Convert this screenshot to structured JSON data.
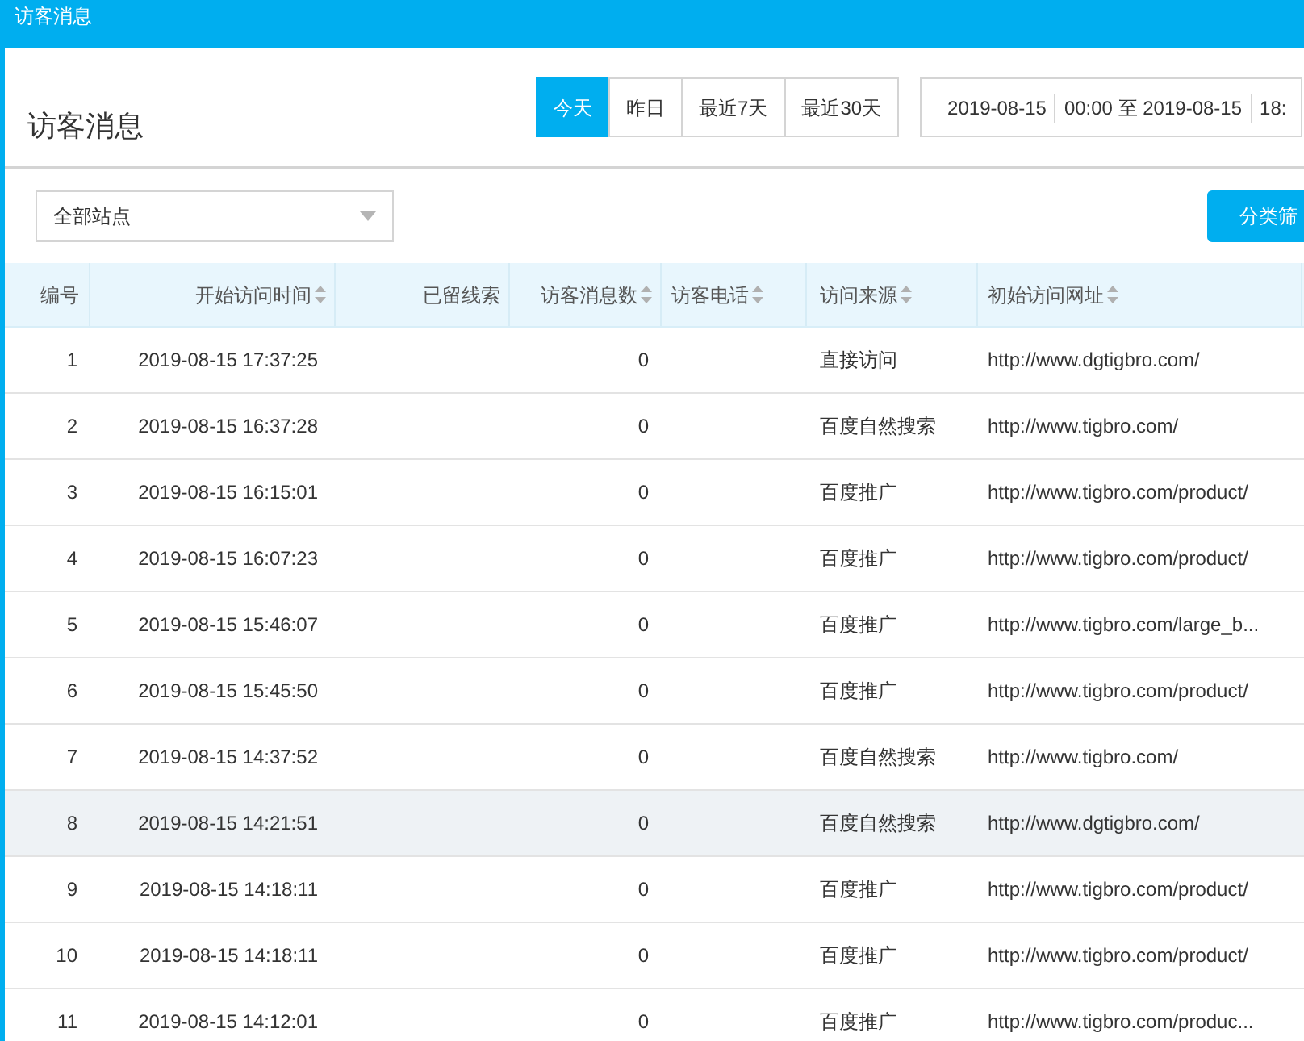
{
  "window": {
    "title": "访客消息"
  },
  "header": {
    "title": "访客消息",
    "ranges": [
      {
        "label": "今天",
        "selected": true
      },
      {
        "label": "昨日",
        "selected": false
      },
      {
        "label": "最近7天",
        "selected": false
      },
      {
        "label": "最近30天",
        "selected": false
      }
    ],
    "date_range": [
      "2019-08-15",
      "00:00 至 2019-08-15",
      "18:"
    ]
  },
  "filter": {
    "site_select": "全部站点",
    "classify_button": "分类筛"
  },
  "table": {
    "columns": [
      {
        "label": "编号",
        "sortable": false
      },
      {
        "label": "开始访问时间",
        "sortable": true
      },
      {
        "label": "已留线索",
        "sortable": false
      },
      {
        "label": "访客消息数",
        "sortable": true
      },
      {
        "label": "访客电话",
        "sortable": true
      },
      {
        "label": "访问来源",
        "sortable": true
      },
      {
        "label": "初始访问网址",
        "sortable": true
      }
    ],
    "rows": [
      {
        "cells": [
          "1",
          "2019-08-15 17:37:25",
          "",
          "0",
          "",
          "直接访问",
          "http://www.dgtigbro.com/"
        ],
        "highlighted": false
      },
      {
        "cells": [
          "2",
          "2019-08-15 16:37:28",
          "",
          "0",
          "",
          "百度自然搜索",
          "http://www.tigbro.com/"
        ],
        "highlighted": false
      },
      {
        "cells": [
          "3",
          "2019-08-15 16:15:01",
          "",
          "0",
          "",
          "百度推广",
          "http://www.tigbro.com/product/"
        ],
        "highlighted": false
      },
      {
        "cells": [
          "4",
          "2019-08-15 16:07:23",
          "",
          "0",
          "",
          "百度推广",
          "http://www.tigbro.com/product/"
        ],
        "highlighted": false
      },
      {
        "cells": [
          "5",
          "2019-08-15 15:46:07",
          "",
          "0",
          "",
          "百度推广",
          "http://www.tigbro.com/large_b..."
        ],
        "highlighted": false
      },
      {
        "cells": [
          "6",
          "2019-08-15 15:45:50",
          "",
          "0",
          "",
          "百度推广",
          "http://www.tigbro.com/product/"
        ],
        "highlighted": false
      },
      {
        "cells": [
          "7",
          "2019-08-15 14:37:52",
          "",
          "0",
          "",
          "百度自然搜索",
          "http://www.tigbro.com/"
        ],
        "highlighted": false
      },
      {
        "cells": [
          "8",
          "2019-08-15 14:21:51",
          "",
          "0",
          "",
          "百度自然搜索",
          "http://www.dgtigbro.com/"
        ],
        "highlighted": true
      },
      {
        "cells": [
          "9",
          "2019-08-15 14:18:11",
          "",
          "0",
          "",
          "百度推广",
          "http://www.tigbro.com/product/"
        ],
        "highlighted": false
      },
      {
        "cells": [
          "10",
          "2019-08-15 14:18:11",
          "",
          "0",
          "",
          "百度推广",
          "http://www.tigbro.com/product/"
        ],
        "highlighted": false
      },
      {
        "cells": [
          "11",
          "2019-08-15 14:12:01",
          "",
          "0",
          "",
          "百度推广",
          "http://www.tigbro.com/produc..."
        ],
        "highlighted": false
      }
    ]
  }
}
